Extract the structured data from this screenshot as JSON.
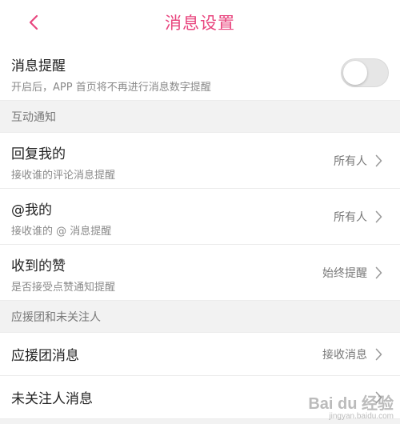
{
  "header": {
    "title": "消息设置",
    "back_icon": "chevron-left-icon",
    "accent_color": "#e8457e"
  },
  "message_reminder": {
    "label": "消息提醒",
    "description": "开启后，APP 首页将不再进行消息数字提醒",
    "toggle_on": false
  },
  "section_interaction": {
    "title": "互动通知",
    "items": [
      {
        "label": "回复我的",
        "description": "接收谁的评论消息提醒",
        "value": "所有人"
      },
      {
        "label": "@我的",
        "description": "接收谁的 @ 消息提醒",
        "value": "所有人"
      },
      {
        "label": "收到的赞",
        "description": "是否接受点赞通知提醒",
        "value": "始终提醒"
      }
    ]
  },
  "section_support": {
    "title": "应援团和未关注人",
    "items": [
      {
        "label": "应援团消息",
        "value": "接收消息"
      },
      {
        "label": "未关注人消息",
        "value": ""
      }
    ]
  },
  "watermark": {
    "logo_text": "Bai du 经验",
    "url": "jingyan.baidu.com"
  }
}
